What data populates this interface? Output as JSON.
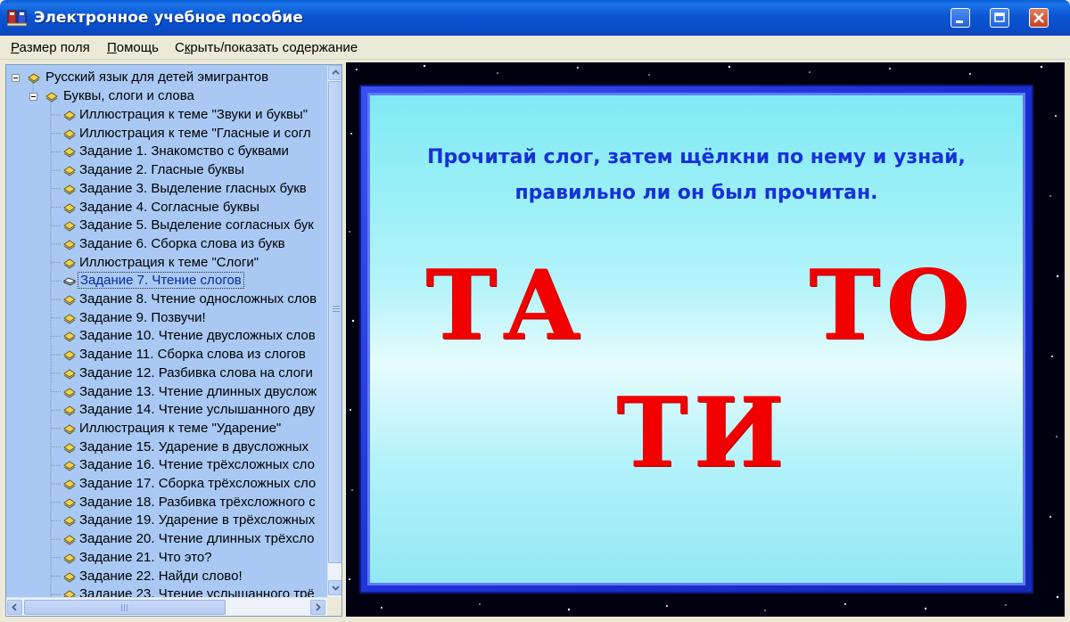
{
  "window": {
    "title": "Электронное учебное пособие"
  },
  "menu": [
    {
      "u": "Р",
      "rest": "азмер поля"
    },
    {
      "u": "П",
      "rest": "омощь"
    },
    {
      "pre": "С",
      "u": "к",
      "rest": "рыть/показать содержание"
    }
  ],
  "tree": {
    "root": "Русский язык для детей эмигрантов",
    "section": "Буквы, слоги и слова",
    "items": [
      "Иллюстрация к теме \"Звуки и буквы\"",
      "Иллюстрация к теме \"Гласные и согл",
      "Задание 1. Знакомство с буквами",
      "Задание 2. Гласные буквы",
      "Задание 3. Выделение гласных букв",
      "Задание 4. Согласные буквы",
      "Задание 5. Выделение согласных бук",
      "Задание 6. Сборка слова из букв",
      "Иллюстрация к теме \"Слоги\"",
      "Задание 7. Чтение слогов",
      "Задание 8. Чтение односложных слов",
      "Задание 9. Позвучи!",
      "Задание 10. Чтение двусложных слов",
      "Задание 11. Сборка слова из слогов",
      "Задание 12. Разбивка слова на слоги",
      "Задание 13. Чтение длинных двуслож",
      "Задание 14. Чтение услышанного дву",
      "Иллюстрация к теме \"Ударение\"",
      "Задание 15. Ударение в двусложных",
      "Задание 16. Чтение трёхсложных сло",
      "Задание 17. Сборка трёхсложных сло",
      "Задание 18. Разбивка трёхсложного с",
      "Задание 19. Ударение в трёхсложных",
      "Задание 20. Чтение длинных трёхсло",
      "Задание 21. Что это?",
      "Задание 22. Найди слово!",
      "Задание 23. Чтение услышанного трё"
    ],
    "selected_index": 9
  },
  "exercise": {
    "instruction_line1": "Прочитай слог, затем щёлкни по нему и узнай,",
    "instruction_line2": "правильно ли он был прочитан.",
    "syllables": [
      "ТА",
      "ТО",
      "ТИ"
    ]
  },
  "colors": {
    "titlebar": "#0B55D3",
    "tree_bg": "#A9C9F4",
    "card_border": "#1C2FD6",
    "card_bg": "#B6F4FA",
    "instruction": "#1730D9",
    "syllable": "#F20000"
  },
  "icons": {
    "app": "app-icon",
    "tree_book": "book-icon",
    "tree_open_book": "open-book-icon"
  }
}
